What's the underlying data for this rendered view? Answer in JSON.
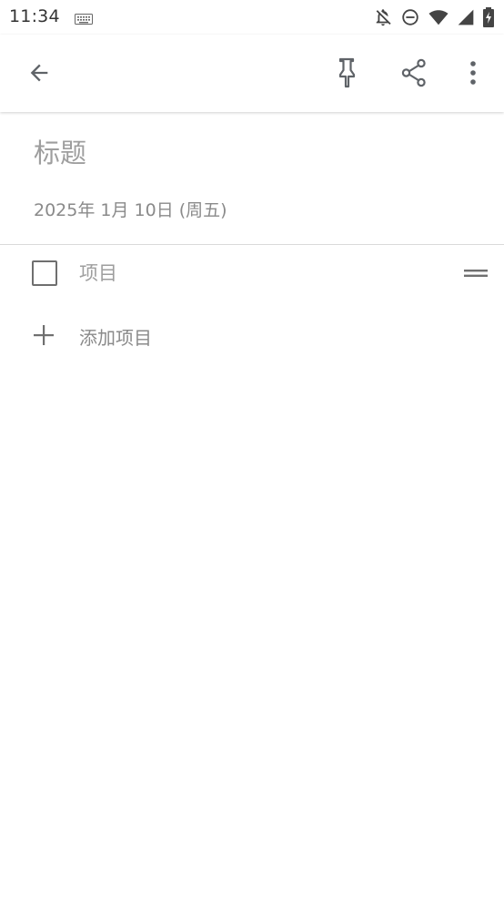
{
  "status_bar": {
    "time": "11:34",
    "icons": [
      "keyboard-icon",
      "notifications-off-icon",
      "do-not-disturb-icon",
      "wifi-icon",
      "cell-signal-icon",
      "battery-charging-icon"
    ]
  },
  "app_bar": {
    "icons": [
      "arrow-back-icon",
      "pin-icon",
      "share-icon",
      "more-vert-icon"
    ]
  },
  "note": {
    "title_placeholder": "标题",
    "date": "2025年 1月 10日 (周五)",
    "items": [
      {
        "placeholder": "项目",
        "checked": false
      }
    ],
    "add_item_label": "添加项目"
  },
  "colors": {
    "icon_gray": "#5f6368",
    "placeholder_gray": "#9e9e9e",
    "divider": "#dadada"
  }
}
